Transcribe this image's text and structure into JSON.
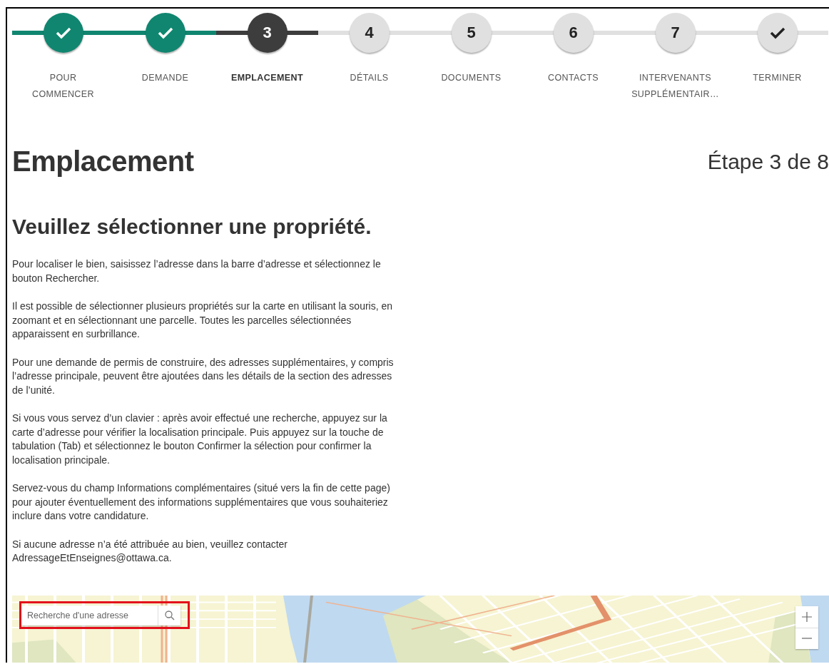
{
  "stepper": [
    {
      "label": "POUR COMMENCER",
      "kind": "check",
      "completed": true,
      "selected": false
    },
    {
      "label": "DEMANDE",
      "kind": "check",
      "completed": true,
      "selected": false
    },
    {
      "label": "EMPLACEMENT",
      "kind": "number",
      "number": "3",
      "completed": false,
      "selected": true
    },
    {
      "label": "DÉTAILS",
      "kind": "number",
      "number": "4",
      "completed": false,
      "selected": false
    },
    {
      "label": "DOCUMENTS",
      "kind": "number",
      "number": "5",
      "completed": false,
      "selected": false
    },
    {
      "label": "CONTACTS",
      "kind": "number",
      "number": "6",
      "completed": false,
      "selected": false
    },
    {
      "label": "INTERVENANTS SUPPLÉMENTAIR…",
      "kind": "number",
      "number": "7",
      "completed": false,
      "selected": false
    },
    {
      "label": "TERMINER",
      "kind": "check",
      "completed": false,
      "selected": false
    }
  ],
  "page_title": "Emplacement",
  "step_indicator": "Étape 3 de 8",
  "section_title": "Veuillez sélectionner une propriété.",
  "paragraphs": [
    "Pour localiser le bien, saisissez l’adresse dans la barre d’adresse et sélectionnez le bouton Rechercher.",
    "Il est possible de sélectionner plusieurs propriétés sur la carte en utilisant la souris, en zoomant et en sélectionnant une parcelle. Toutes les parcelles sélectionnées apparaissent en surbrillance.",
    "Pour une demande de permis de construire, des adresses supplémentaires, y compris l’adresse principale, peuvent être ajoutées dans les détails de la section des adresses de l’unité.",
    "Si vous vous servez d’un clavier : après avoir effectué une recherche, appuyez sur la carte d’adresse pour vérifier la localisation principale. Puis appuyez sur la touche de tabulation (Tab) et sélectionnez le bouton Confirmer la sélection pour confirmer la localisation principale.",
    "Servez-vous du champ Informations complémentaires (situé vers la fin de cette page) pour ajouter éventuellement des informations supplémentaires que vous souhaiteriez inclure dans votre candidature.",
    "Si aucune adresse n’a été attribuée au bien, veuillez contacter AdressageEtEnseignes@ottawa.ca."
  ],
  "map": {
    "search": {
      "placeholder": "Recherche d'une adresse",
      "highlighted": true
    }
  }
}
